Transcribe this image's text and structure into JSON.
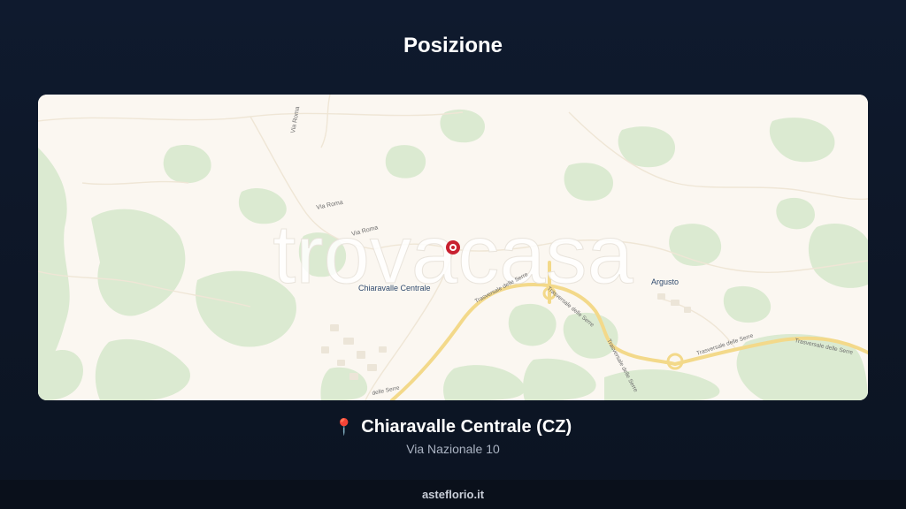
{
  "header": {
    "title": "Posizione"
  },
  "map": {
    "watermark": "trovacasa",
    "labels": {
      "town": "Chiaravalle Centrale",
      "argusto": "Argusto",
      "via_roma_1": "Via Roma",
      "via_roma_2": "Via Roma",
      "via_roma_3": "Via Roma",
      "road_1": "Trasversale delle Serre",
      "road_2": "Trasversale delle Serre",
      "road_3": "Trasversale delle Serre",
      "road_4": "Trasversale delle Serre",
      "road_5": "Trasversale delle Serre",
      "road_6": "delle Serre"
    },
    "colors": {
      "land": "#fbf7f1",
      "green": "#dcebd3",
      "road": "#f3d98a",
      "marker": "#c8202f"
    }
  },
  "location": {
    "pin_icon": "map-pin-icon",
    "name": "Chiaravalle Centrale (CZ)",
    "address": "Via Nazionale 10"
  },
  "footer": {
    "site": "asteflorio.it"
  }
}
